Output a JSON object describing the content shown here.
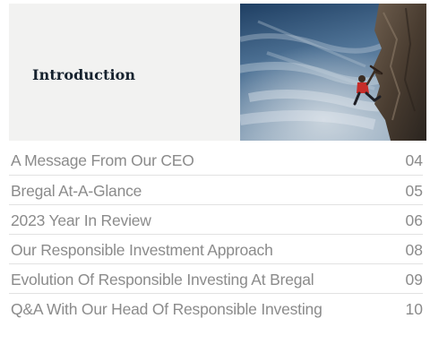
{
  "section": {
    "title": "Introduction"
  },
  "photo": {
    "subject": "rock climber on cliff against cloudy sky"
  },
  "toc": {
    "entries": [
      {
        "label": "A Message From Our CEO",
        "page": "04"
      },
      {
        "label": "Bregal At-A-Glance",
        "page": "05"
      },
      {
        "label": "2023 Year In Review",
        "page": "06"
      },
      {
        "label": "Our Responsible Investment Approach",
        "page": "08"
      },
      {
        "label": "Evolution Of Responsible Investing At Bregal",
        "page": "09"
      },
      {
        "label": "Q&A With Our Head Of Responsible Investing",
        "page": "10"
      }
    ]
  },
  "colors": {
    "header_band": "#f2f2f1",
    "title_text": "#16222e",
    "toc_text": "#8b8b8b",
    "divider": "#e2e2e2"
  }
}
